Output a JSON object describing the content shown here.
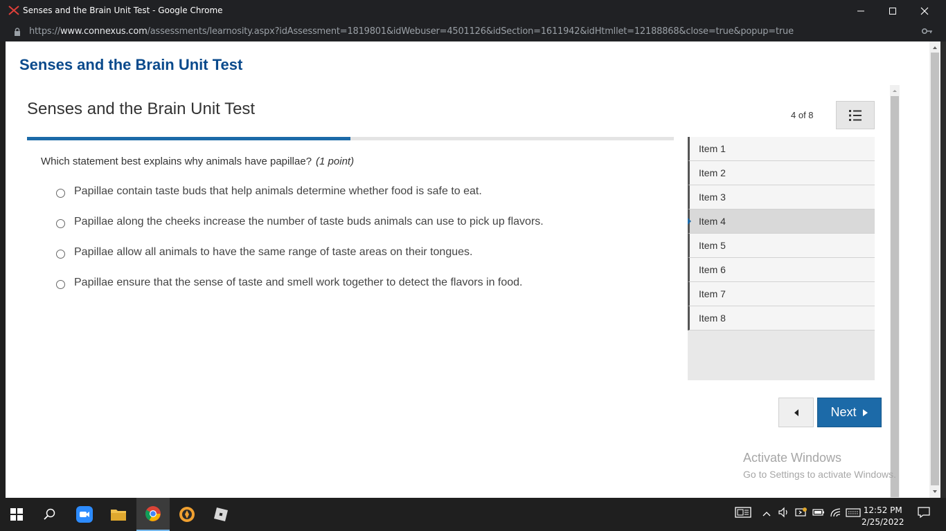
{
  "browser": {
    "window_title": "Senses and the Brain Unit Test - Google Chrome",
    "url_prefix": "https://",
    "url_host": "www.connexus.com",
    "url_path": "/assessments/learnosity.aspx?idAssessment=1819801&idWebuser=4501126&idSection=1611942&idHtmllet=12188868&close=true&popup=true"
  },
  "page": {
    "heading": "Senses and the Brain Unit Test"
  },
  "assessment": {
    "title": "Senses and the Brain Unit Test",
    "counter": "4 of 8",
    "progress_fraction": 0.5,
    "question": "Which statement best explains why animals have papillae?",
    "points": "(1 point)",
    "options": [
      "Papillae contain taste buds that help animals determine whether food is safe to eat.",
      "Papillae along the cheeks increase the number of taste buds animals can use to pick up flavors.",
      "Papillae allow all animals to have the same range of taste areas on their tongues.",
      "Papillae ensure that the sense of taste and smell work together to detect the flavors in food."
    ],
    "items": [
      "Item 1",
      "Item 2",
      "Item 3",
      "Item 4",
      "Item 5",
      "Item 6",
      "Item 7",
      "Item 8"
    ],
    "active_item": 4,
    "next_label": "Next"
  },
  "watermark": {
    "line1": "Activate Windows",
    "line2": "Go to Settings to activate Windows."
  },
  "taskbar": {
    "time": "12:52 PM",
    "date": "2/25/2022"
  },
  "colors": {
    "accent": "#1c6aa8",
    "page_heading": "#0a4a8c"
  }
}
